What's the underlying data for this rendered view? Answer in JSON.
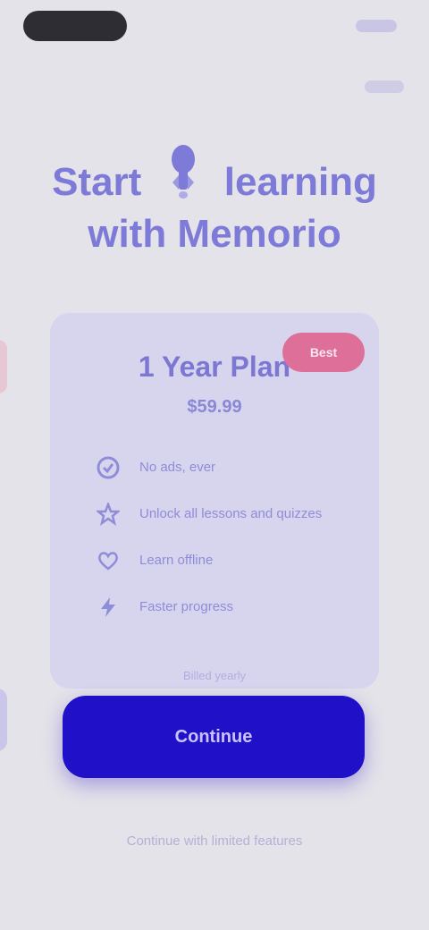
{
  "status": {
    "time": ""
  },
  "header": {
    "top_right_a": "",
    "top_right_b": ""
  },
  "headline": {
    "part1": "Start",
    "icon": "rocket-icon",
    "part2": "learning",
    "line2": "with Memorio"
  },
  "plan": {
    "badge": "Best",
    "name": "1 Year Plan",
    "price": "$59.99",
    "features": [
      {
        "icon": "check-icon",
        "text": "No ads, ever"
      },
      {
        "icon": "star-icon",
        "text": "Unlock all lessons and quizzes"
      },
      {
        "icon": "heart-icon",
        "text": "Learn offline"
      },
      {
        "icon": "bolt-icon",
        "text": "Faster progress"
      }
    ],
    "footnote": "Billed yearly"
  },
  "cta": {
    "label": "Continue"
  },
  "footer": {
    "link": "Continue with limited features"
  },
  "colors": {
    "accent": "#2011c9",
    "headline": "#7e7ad8",
    "badge": "#de6f98",
    "card": "#d7d5ee",
    "background": "#e4e3e9"
  }
}
